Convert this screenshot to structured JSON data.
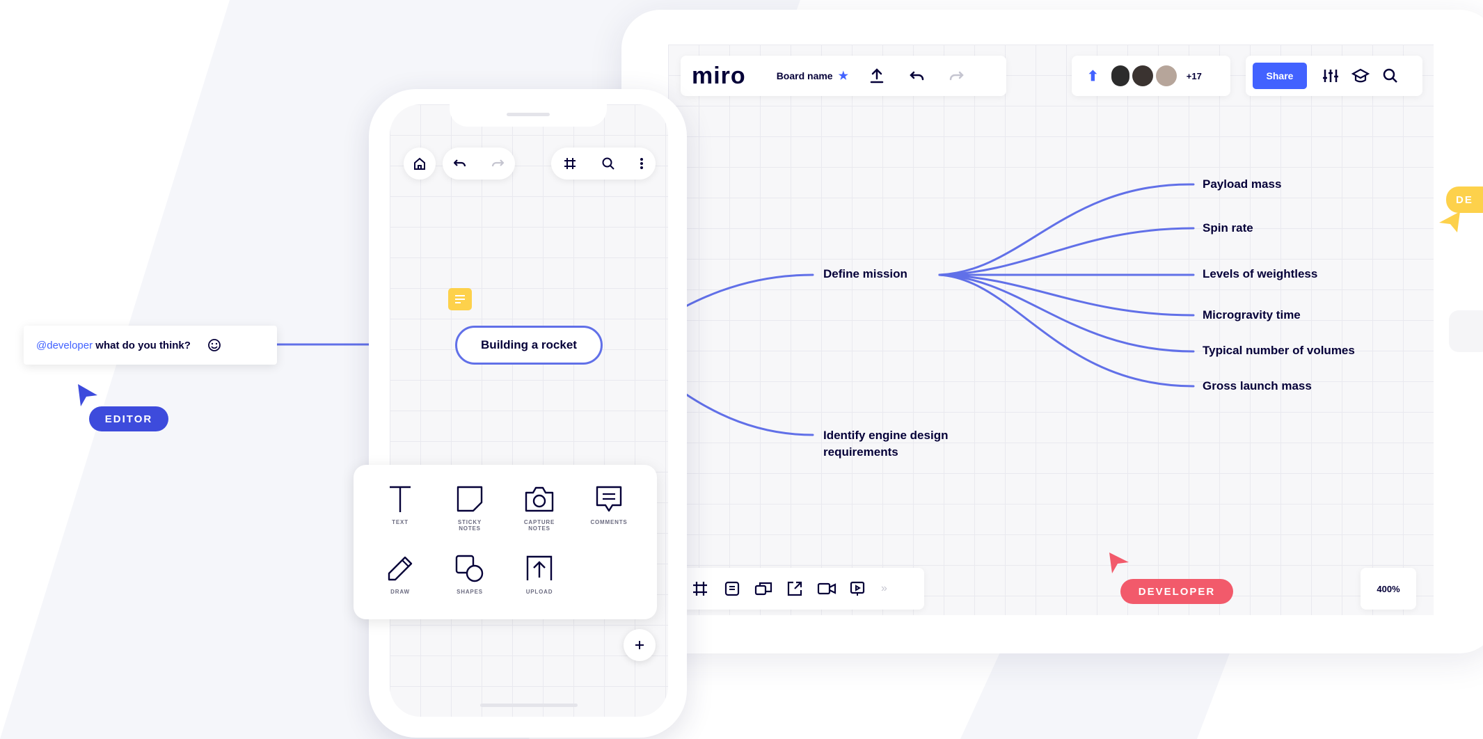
{
  "desktop": {
    "logo": "miro",
    "board_name": "Board name",
    "collaborators_extra": "+17",
    "share_label": "Share",
    "zoom": "400%"
  },
  "mindmap": {
    "root": "Building a rocket",
    "branches": [
      {
        "label": "Define mission"
      },
      {
        "label_line1": "Identify engine design",
        "label_line2": "requirements"
      }
    ],
    "leaves": [
      "Payload mass",
      "Spin rate",
      "Levels of weightless",
      "Microgravity time",
      "Typical number of volumes",
      "Gross launch mass"
    ]
  },
  "comment": {
    "mention": "@developer",
    "text": " what do you think?"
  },
  "cursors": {
    "editor": {
      "label": "EDITOR",
      "color": "#3d4bdc"
    },
    "developer": {
      "label": "DEVELOPER",
      "color": "#f25a6b"
    },
    "offscreen": {
      "label": "DE",
      "color": "#fdd14b"
    }
  },
  "phone_tools": {
    "text": "TEXT",
    "sticky_1": "STICKY",
    "sticky_2": "NOTES",
    "capture_1": "CAPTURE",
    "capture_2": "NOTES",
    "comments": "COMMENTS",
    "draw": "DRAW",
    "shapes": "SHAPES",
    "upload": "UPLOAD"
  },
  "colors": {
    "accent": "#4262ff",
    "line": "#6170e8",
    "text": "#050038"
  }
}
